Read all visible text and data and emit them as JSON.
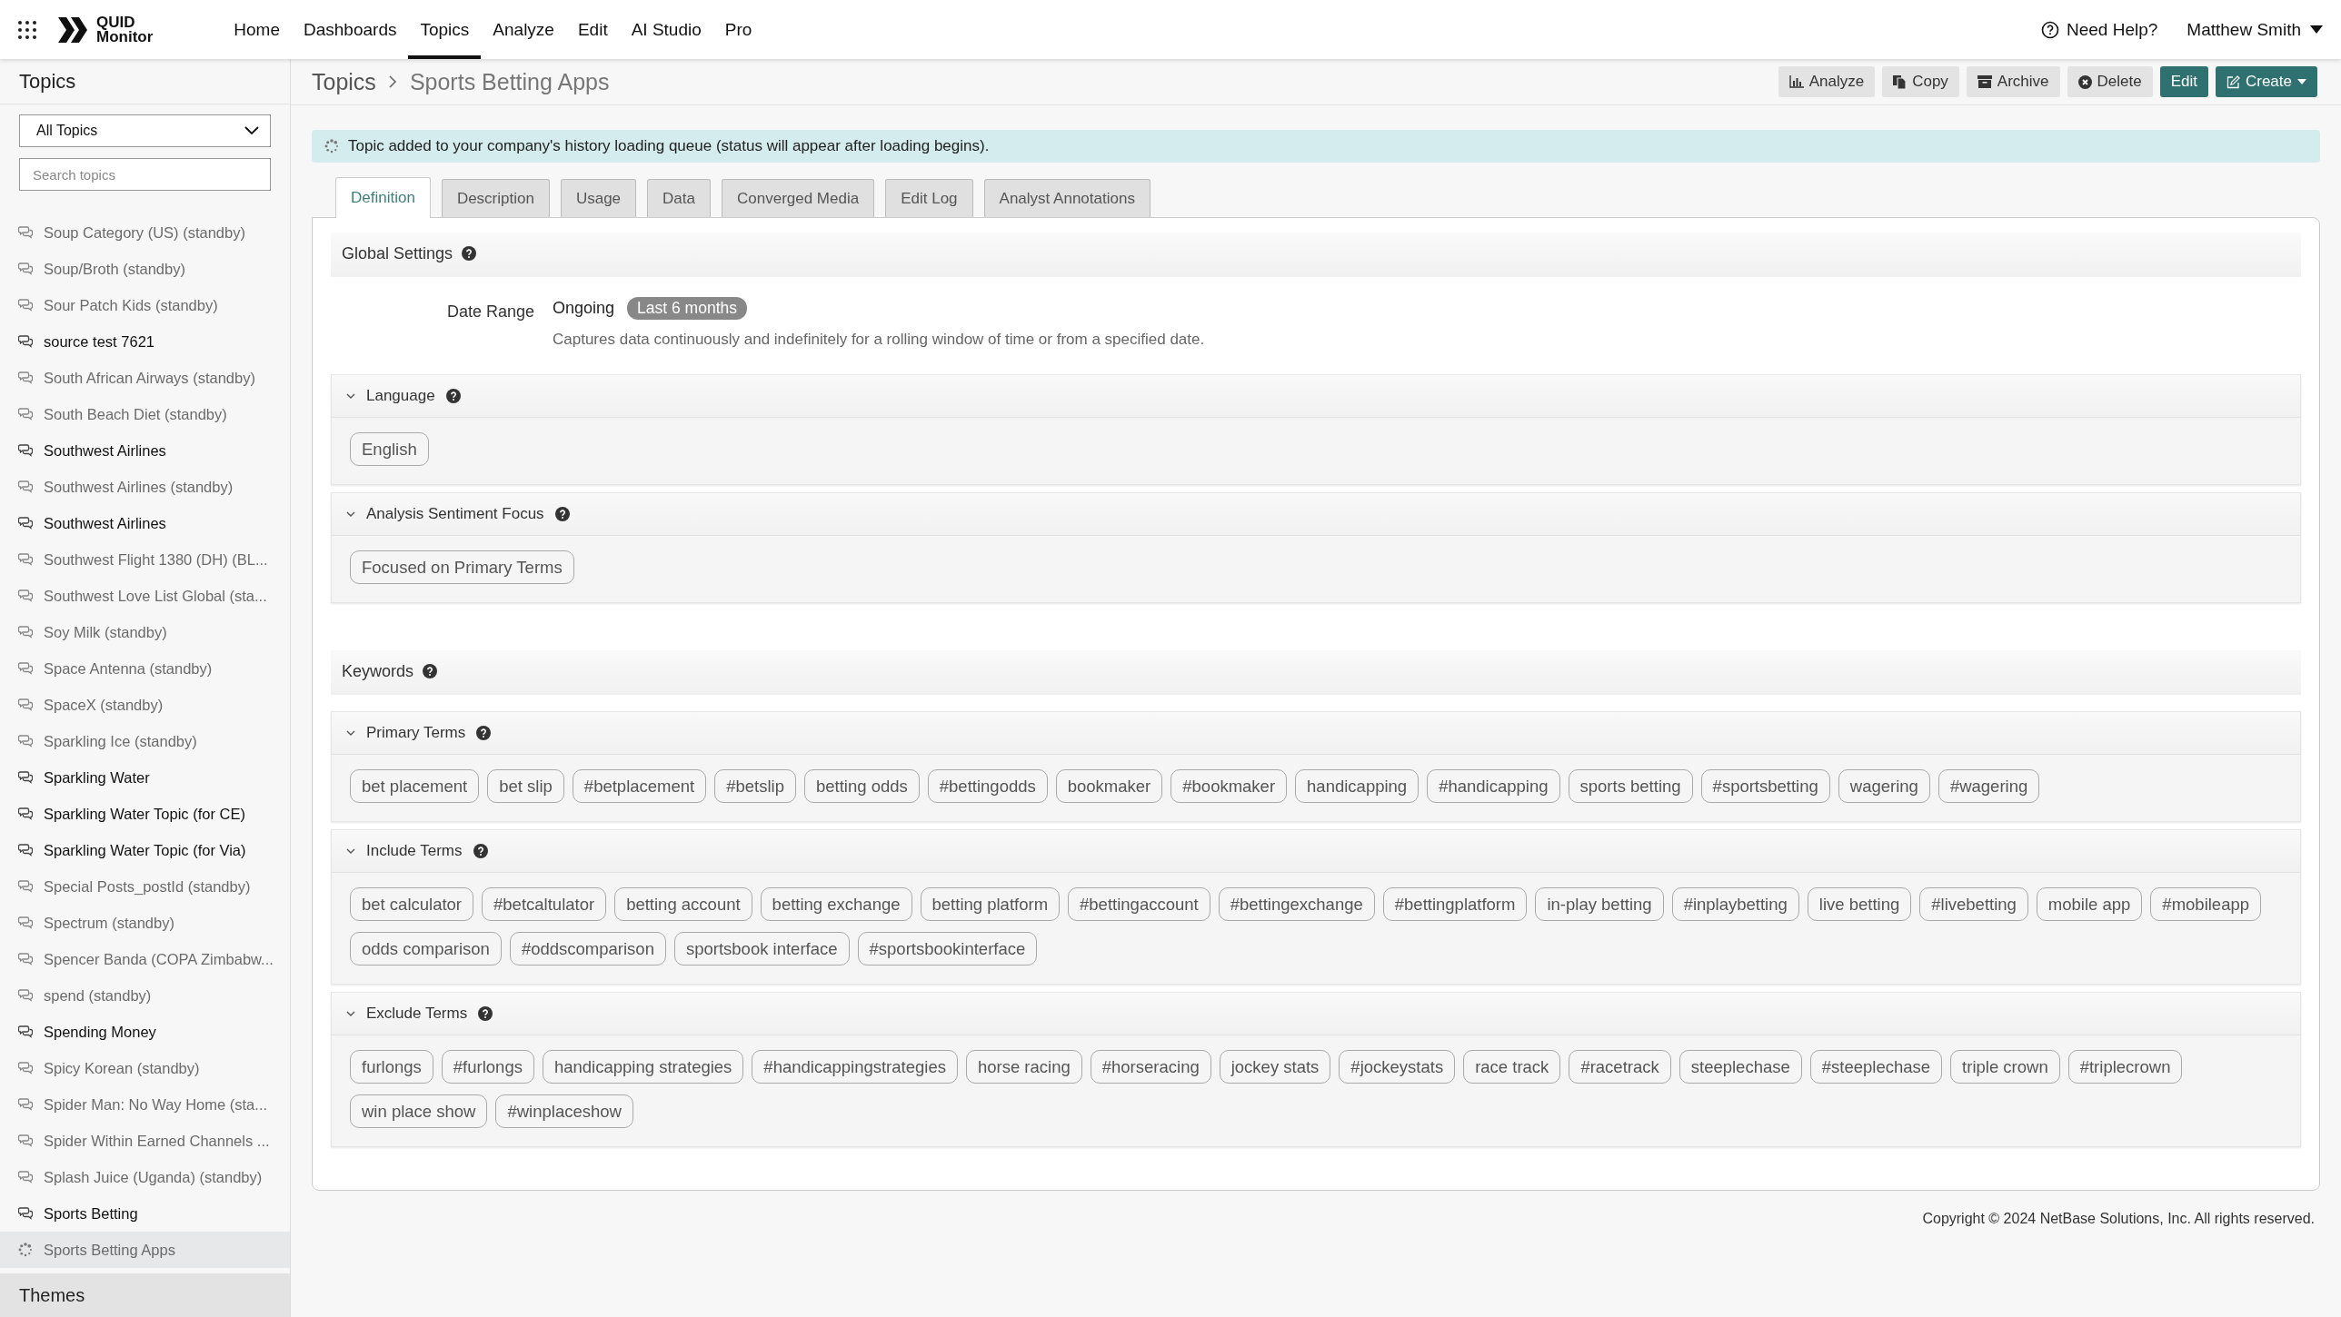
{
  "topbar": {
    "brand": {
      "line1": "QUID",
      "line2": "Monitor"
    },
    "nav": [
      {
        "label": "Home",
        "selected": false
      },
      {
        "label": "Dashboards",
        "selected": false
      },
      {
        "label": "Topics",
        "selected": true
      },
      {
        "label": "Analyze",
        "selected": false
      },
      {
        "label": "Edit",
        "selected": false
      },
      {
        "label": "AI Studio",
        "selected": false
      },
      {
        "label": "Pro",
        "selected": false
      }
    ],
    "help": "Need Help?",
    "user": "Matthew Smith"
  },
  "sidebar": {
    "title": "Topics",
    "filter": "All Topics",
    "search": {
      "placeholder": "Search topics"
    },
    "topics": [
      {
        "label": "Soup Category (US) (standby)",
        "dimmed": true,
        "kind": "topic",
        "selected": false
      },
      {
        "label": "Soup/Broth (standby)",
        "dimmed": true,
        "kind": "topic",
        "selected": false
      },
      {
        "label": "Sour Patch Kids (standby)",
        "dimmed": true,
        "kind": "topic",
        "selected": false
      },
      {
        "label": "source test 7621",
        "dimmed": false,
        "kind": "topic",
        "selected": false
      },
      {
        "label": "South African Airways (standby)",
        "dimmed": true,
        "kind": "topic",
        "selected": false
      },
      {
        "label": "South Beach Diet (standby)",
        "dimmed": true,
        "kind": "topic",
        "selected": false
      },
      {
        "label": "Southwest Airlines",
        "dimmed": false,
        "kind": "topic",
        "selected": false
      },
      {
        "label": "Southwest Airlines (standby)",
        "dimmed": true,
        "kind": "topic",
        "selected": false
      },
      {
        "label": "Southwest Airlines",
        "dimmed": false,
        "kind": "topic",
        "selected": false
      },
      {
        "label": "Southwest Flight 1380 (DH) (BL...",
        "dimmed": true,
        "kind": "topic",
        "selected": false
      },
      {
        "label": "Southwest Love List Global (sta...",
        "dimmed": true,
        "kind": "topic",
        "selected": false
      },
      {
        "label": "Soy Milk (standby)",
        "dimmed": true,
        "kind": "topic",
        "selected": false
      },
      {
        "label": "Space Antenna (standby)",
        "dimmed": true,
        "kind": "topic",
        "selected": false
      },
      {
        "label": "SpaceX (standby)",
        "dimmed": true,
        "kind": "topic",
        "selected": false
      },
      {
        "label": "Sparkling Ice (standby)",
        "dimmed": true,
        "kind": "topic",
        "selected": false
      },
      {
        "label": "Sparkling Water",
        "dimmed": false,
        "kind": "topic",
        "selected": false
      },
      {
        "label": "Sparkling Water Topic (for CE)",
        "dimmed": false,
        "kind": "topic",
        "selected": false
      },
      {
        "label": "Sparkling Water Topic (for Via)",
        "dimmed": false,
        "kind": "topic",
        "selected": false
      },
      {
        "label": "Special Posts_postId (standby)",
        "dimmed": true,
        "kind": "topic",
        "selected": false
      },
      {
        "label": "Spectrum (standby)",
        "dimmed": true,
        "kind": "topic",
        "selected": false
      },
      {
        "label": "Spencer Banda (COPA Zimbabw...",
        "dimmed": true,
        "kind": "topic",
        "selected": false
      },
      {
        "label": "spend (standby)",
        "dimmed": true,
        "kind": "topic",
        "selected": false
      },
      {
        "label": "Spending Money",
        "dimmed": false,
        "kind": "topic",
        "selected": false
      },
      {
        "label": "Spicy Korean (standby)",
        "dimmed": true,
        "kind": "topic",
        "selected": false
      },
      {
        "label": "Spider Man: No Way Home (sta...",
        "dimmed": true,
        "kind": "topic",
        "selected": false
      },
      {
        "label": "Spider Within Earned Channels ...",
        "dimmed": true,
        "kind": "topic",
        "selected": false
      },
      {
        "label": "Splash Juice (Uganda) (standby)",
        "dimmed": true,
        "kind": "topic",
        "selected": false
      },
      {
        "label": "Sports Betting",
        "dimmed": false,
        "kind": "topic",
        "selected": false
      },
      {
        "label": "Sports Betting Apps",
        "dimmed": true,
        "kind": "loading",
        "selected": true
      }
    ],
    "footer": "Themes"
  },
  "breadcrumb": [
    "Topics",
    "Sports Betting Apps"
  ],
  "actions": [
    {
      "label": "Analyze",
      "kind": "analyze",
      "primary": false
    },
    {
      "label": "Copy",
      "kind": "copy",
      "primary": false
    },
    {
      "label": "Archive",
      "kind": "archive",
      "primary": false
    },
    {
      "label": "Delete",
      "kind": "delete",
      "primary": false
    },
    {
      "label": "Edit",
      "kind": "none",
      "primary": true
    },
    {
      "label": "Create",
      "kind": "create",
      "primary": true
    }
  ],
  "alert": "Topic added to your company's history loading queue (status will appear after loading begins).",
  "tabs": [
    {
      "label": "Definition",
      "selected": true
    },
    {
      "label": "Description",
      "selected": false
    },
    {
      "label": "Usage",
      "selected": false
    },
    {
      "label": "Data",
      "selected": false
    },
    {
      "label": "Converged Media",
      "selected": false
    },
    {
      "label": "Edit Log",
      "selected": false
    },
    {
      "label": "Analyst Annotations",
      "selected": false
    }
  ],
  "global_settings": {
    "title": "Global Settings",
    "date_range": {
      "label": "Date Range",
      "value": "Ongoing",
      "badge": "Last 6 months",
      "note": "Captures data continuously and indefinitely for a rolling window of time or from a specified date."
    },
    "sections": [
      {
        "title": "Language",
        "expanded": true,
        "tags": [
          "English"
        ]
      },
      {
        "title": "Analysis Sentiment Focus",
        "expanded": true,
        "tags": [
          "Focused on Primary Terms"
        ]
      }
    ]
  },
  "keywords": {
    "title": "Keywords",
    "sections": [
      {
        "title": "Primary Terms",
        "expanded": true,
        "tags": [
          "bet placement",
          "bet slip",
          "#betplacement",
          "#betslip",
          "betting odds",
          "#bettingodds",
          "bookmaker",
          "#bookmaker",
          "handicapping",
          "#handicapping",
          "sports betting",
          "#sportsbetting",
          "wagering",
          "#wagering"
        ]
      },
      {
        "title": "Include Terms",
        "expanded": true,
        "tags": [
          "bet calculator",
          "#betcaltulator",
          "betting account",
          "betting exchange",
          "betting platform",
          "#bettingaccount",
          "#bettingexchange",
          "#bettingplatform",
          "in-play betting",
          "#inplaybetting",
          "live betting",
          "#livebetting",
          "mobile app",
          "#mobileapp",
          "odds comparison",
          "#oddscomparison",
          "sportsbook interface",
          "#sportsbookinterface"
        ]
      },
      {
        "title": "Exclude Terms",
        "expanded": true,
        "tags": [
          "furlongs",
          "#furlongs",
          "handicapping strategies",
          "#handicappingstrategies",
          "horse racing",
          "#horseracing",
          "jockey stats",
          "#jockeystats",
          "race track",
          "#racetrack",
          "steeplechase",
          "#steeplechase",
          "triple crown",
          "#triplecrown",
          "win place show",
          "#winplaceshow"
        ]
      }
    ]
  },
  "copyright": "Copyright © 2024 NetBase Solutions, Inc. All rights reserved."
}
